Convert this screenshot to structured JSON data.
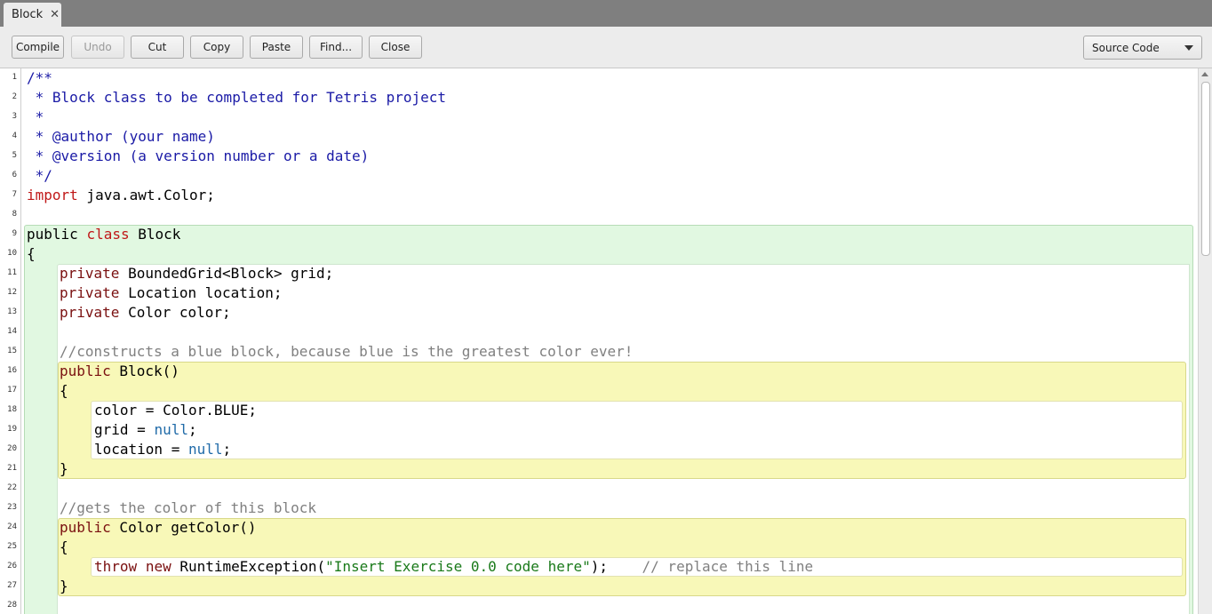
{
  "tab": {
    "label": "Block",
    "close_glyph": "✕"
  },
  "toolbar": {
    "compile": "Compile",
    "undo": "Undo",
    "cut": "Cut",
    "copy": "Copy",
    "paste": "Paste",
    "find": "Find...",
    "close": "Close",
    "view_select": "Source Code"
  },
  "line_numbers": [
    "1",
    "2",
    "3",
    "4",
    "5",
    "6",
    "7",
    "8",
    "9",
    "10",
    "11",
    "12",
    "13",
    "14",
    "15",
    "16",
    "17",
    "18",
    "19",
    "20",
    "21",
    "22",
    "23",
    "24",
    "25",
    "26",
    "27",
    "28"
  ],
  "code": {
    "l1": "/**",
    "l2": " * Block class to be completed for Tetris project",
    "l3": " *",
    "l4": " * @author (your name)",
    "l5": " * @version (a version number or a date)",
    "l6": " */",
    "l7_kw": "import",
    "l7_rest": " java.awt.Color;",
    "l9_kw1": "public",
    "l9_kw2": "class",
    "l9_rest": " Block",
    "l10": "{",
    "l11_kw": "private",
    "l11_rest": " BoundedGrid<Block> grid;",
    "l12_kw": "private",
    "l12_rest": " Location location;",
    "l13_kw": "private",
    "l13_rest": " Color color;",
    "l15": "//constructs a blue block, because blue is the greatest color ever!",
    "l16_kw": "public",
    "l16_rest": " Block()",
    "l17": "{",
    "l18": "color = Color.BLUE;",
    "l19_a": "grid = ",
    "l19_null": "null",
    "l19_b": ";",
    "l20_a": "location = ",
    "l20_null": "null",
    "l20_b": ";",
    "l21": "}",
    "l23": "//gets the color of this block",
    "l24_kw": "public",
    "l24_rest": " Color getColor()",
    "l25": "{",
    "l26_kw1": "throw",
    "l26_kw2": "new",
    "l26_a": " RuntimeException(",
    "l26_str": "\"Insert Exercise 0.0 code here\"",
    "l26_b": ");",
    "l26_cmt": "    // replace this line",
    "l27": "}"
  },
  "colors": {
    "class_scope": "#e1f8e1",
    "method_scope": "#f8f8b8",
    "keyword": "#7a1010",
    "doc_comment": "#1a1aa6",
    "comment": "#808080",
    "string": "#1a7a1a"
  }
}
